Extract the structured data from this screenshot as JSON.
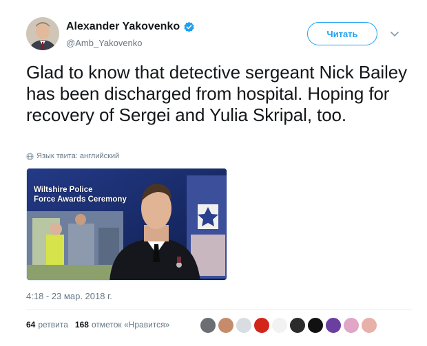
{
  "author": {
    "display_name": "Alexander Yakovenko",
    "handle": "@Amb_Yakovenko",
    "verified": true
  },
  "follow_button_label": "Читать",
  "tweet_text": "Glad to know that detective sergeant Nick Bailey has been discharged from hospital. Hoping for recovery of Sergei and Yulia Skripal, too.",
  "language_note": "Язык твита: английский",
  "media": {
    "caption_line1": "Wiltshire Police",
    "caption_line2": "Force Awards Ceremony"
  },
  "timestamp": "4:18 - 23 мар. 2018 г.",
  "stats": {
    "retweets_count": "64",
    "retweets_label": "ретвита",
    "likes_count": "168",
    "likes_label": "отметок «Нравится»"
  },
  "liker_avatars": [
    {
      "icon": "avatar-gray",
      "color": "#6b6f74"
    },
    {
      "icon": "avatar-woman",
      "color": "#c58b6b"
    },
    {
      "icon": "avatar-light",
      "color": "#d8dde2"
    },
    {
      "icon": "avatar-hammer-sickle",
      "color": "#d2261b"
    },
    {
      "icon": "avatar-figure",
      "color": "#f2f2f2"
    },
    {
      "icon": "avatar-dark",
      "color": "#2b2b2b"
    },
    {
      "icon": "avatar-black-figure",
      "color": "#111111"
    },
    {
      "icon": "avatar-purple",
      "color": "#6a3fa0"
    },
    {
      "icon": "avatar-pink-flower",
      "color": "#e0a6c6"
    },
    {
      "icon": "avatar-pink",
      "color": "#e7b1a9"
    }
  ],
  "colors": {
    "accent": "#1da1f2",
    "secondary_text": "#657786",
    "primary_text": "#14171a"
  }
}
